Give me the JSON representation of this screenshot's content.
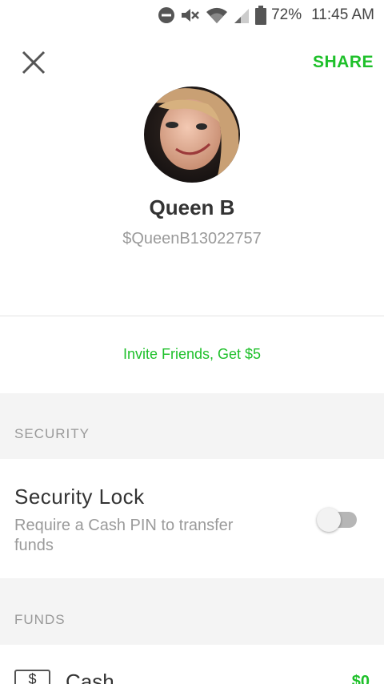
{
  "status_bar": {
    "battery_percent": "72%",
    "time": "11:45 AM"
  },
  "header": {
    "share_label": "SHARE"
  },
  "profile": {
    "name": "Queen B",
    "cashtag": "$QueenB13022757"
  },
  "invite": {
    "label": "Invite Friends, Get $5"
  },
  "security": {
    "section_title": "SECURITY",
    "lock_title": "Security Lock",
    "lock_description": "Require a Cash PIN to transfer funds",
    "lock_enabled": false
  },
  "funds": {
    "section_title": "FUNDS",
    "cash_icon_symbol": "$",
    "cash_label": "Cash",
    "cash_amount": "$0"
  },
  "colors": {
    "accent": "#1ec02a",
    "section_bg": "#f4f4f4"
  }
}
